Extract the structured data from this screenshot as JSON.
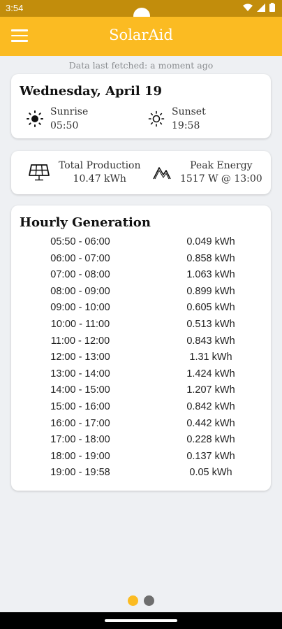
{
  "status_bar": {
    "time": "3:54"
  },
  "app_bar": {
    "title": "SolarAid"
  },
  "fetched_text": "Data last fetched: a moment ago",
  "day": {
    "date": "Wednesday, April 19",
    "sunrise_label": "Sunrise",
    "sunrise_time": "05:50",
    "sunset_label": "Sunset",
    "sunset_time": "19:58"
  },
  "production": {
    "total_label": "Total Production",
    "total_value": "10.47 kWh",
    "peak_label": "Peak Energy",
    "peak_value": "1517 W @ 13:00"
  },
  "hourly": {
    "title": "Hourly Generation",
    "rows": [
      {
        "range": "05:50 - 06:00",
        "value": "0.049 kWh"
      },
      {
        "range": "06:00 - 07:00",
        "value": "0.858 kWh"
      },
      {
        "range": "07:00 - 08:00",
        "value": "1.063 kWh"
      },
      {
        "range": "08:00 - 09:00",
        "value": "0.899 kWh"
      },
      {
        "range": "09:00 - 10:00",
        "value": "0.605 kWh"
      },
      {
        "range": "10:00 - 11:00",
        "value": "0.513 kWh"
      },
      {
        "range": "11:00 - 12:00",
        "value": "0.843 kWh"
      },
      {
        "range": "12:00 - 13:00",
        "value": "1.31 kWh"
      },
      {
        "range": "13:00 - 14:00",
        "value": "1.424 kWh"
      },
      {
        "range": "14:00 - 15:00",
        "value": "1.207 kWh"
      },
      {
        "range": "15:00 - 16:00",
        "value": "0.842 kWh"
      },
      {
        "range": "16:00 - 17:00",
        "value": "0.442 kWh"
      },
      {
        "range": "17:00 - 18:00",
        "value": "0.228 kWh"
      },
      {
        "range": "18:00 - 19:00",
        "value": "0.137 kWh"
      },
      {
        "range": "19:00 - 19:58",
        "value": "0.05 kWh"
      }
    ]
  },
  "pager": {
    "pages": 2,
    "active": 0
  },
  "colors": {
    "accent": "#fbbb22",
    "status_bar": "#c28d0c",
    "background": "#eef0f3",
    "pager_inactive": "#6e6e6e"
  },
  "icons": {
    "menu": "hamburger-icon",
    "sunrise": "sun-filled-icon",
    "sunset": "sun-outline-icon",
    "production": "solar-panel-icon",
    "peak": "zigzag-chart-icon"
  }
}
